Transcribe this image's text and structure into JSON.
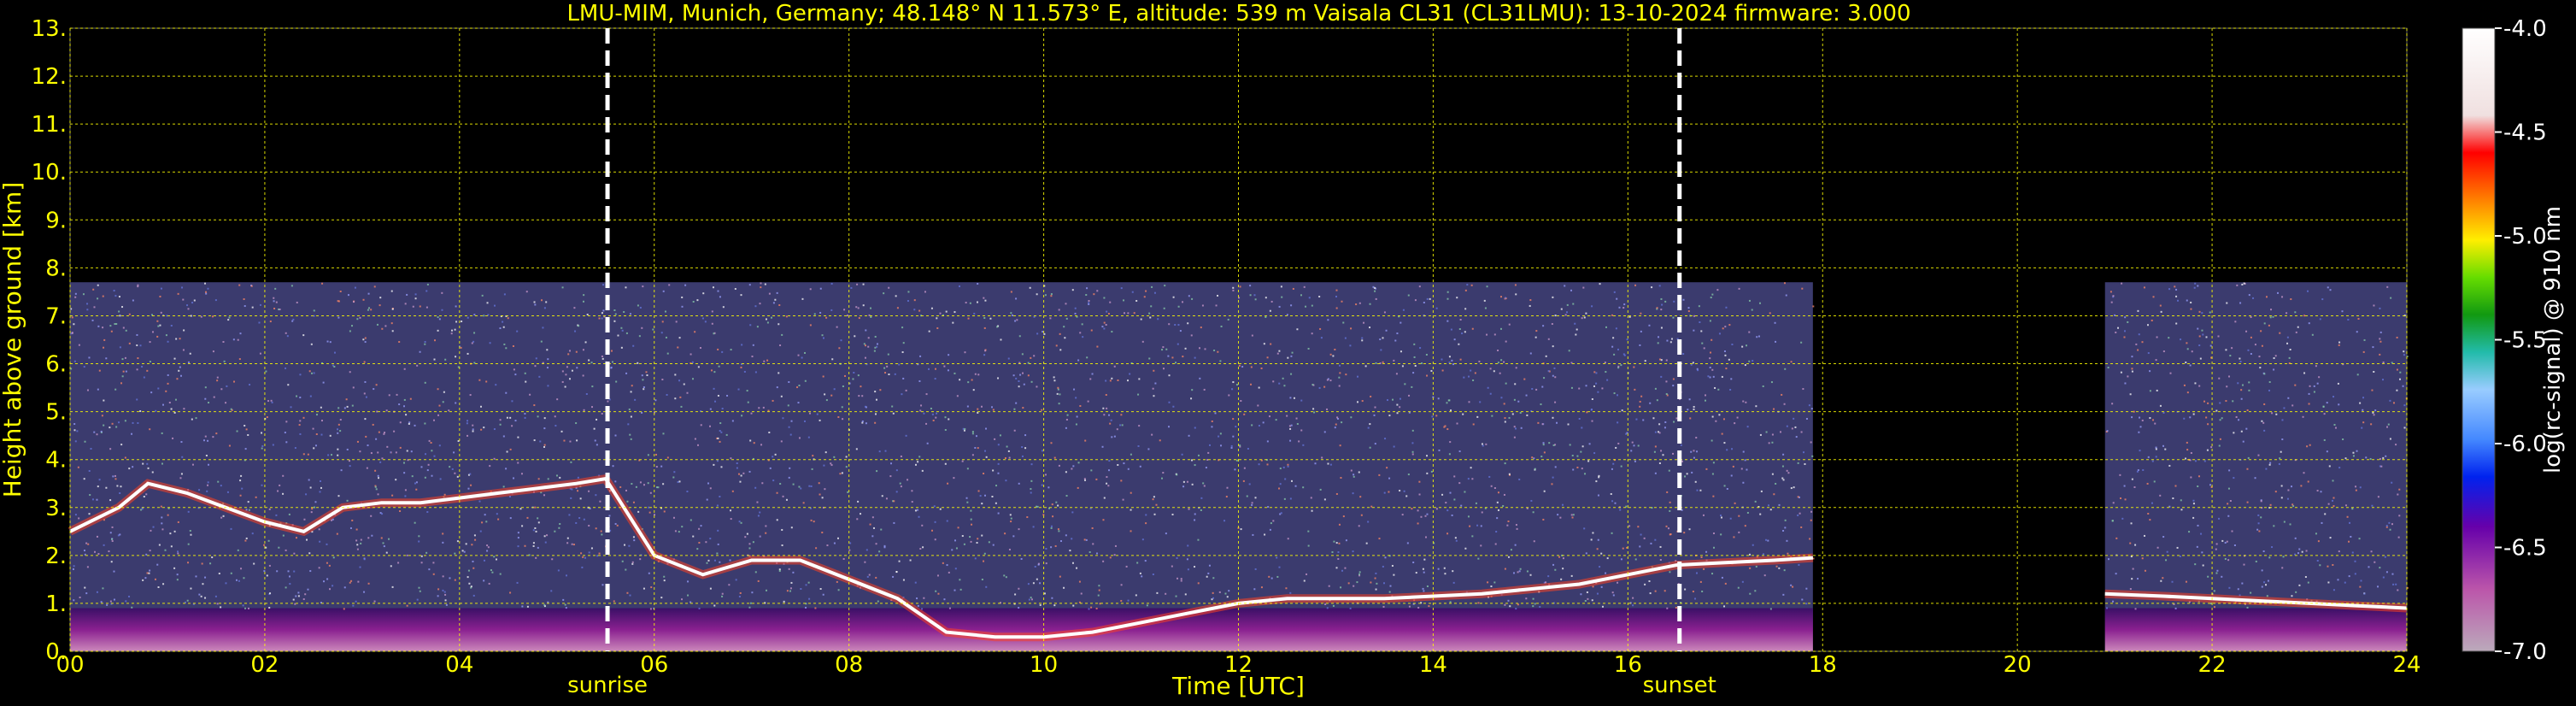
{
  "chart_data": {
    "type": "heatmap",
    "title": "LMU-MIM, Munich, Germany; 48.148° N 11.573° E, altitude: 539 m    Vaisala CL31 (CL31LMU): 13-10-2024    firmware: 3.000",
    "xlabel": "Time [UTC]",
    "ylabel": "Height above ground [km]",
    "xlim": [
      0,
      24
    ],
    "ylim": [
      0,
      13
    ],
    "x_ticks": [
      "00",
      "02",
      "04",
      "06",
      "08",
      "10",
      "12",
      "14",
      "16",
      "18",
      "20",
      "22",
      "24"
    ],
    "y_ticks": [
      "0.",
      "1.",
      "2.",
      "3.",
      "4.",
      "5.",
      "6.",
      "7.",
      "8.",
      "9.",
      "10.",
      "11.",
      "12.",
      "13."
    ],
    "grid": true,
    "colorbar": {
      "label": "log(rc-signal) @ 910 nm",
      "range": [
        -7.0,
        -4.0
      ],
      "ticks": [
        "-4.0",
        "-4.5",
        "-5.0",
        "-5.5",
        "-6.0",
        "-6.5",
        "-7.0"
      ]
    },
    "markers": [
      {
        "label": "sunrise",
        "time_utc": 5.52
      },
      {
        "label": "sunset",
        "time_utc": 16.53
      }
    ],
    "data_gaps_utc": [
      [
        17.9,
        20.9
      ]
    ],
    "signal_top_km": 7.7,
    "boundary_layer_top": {
      "x": [
        0.0,
        0.5,
        0.8,
        1.2,
        1.6,
        2.0,
        2.4,
        2.8,
        3.2,
        3.6,
        4.0,
        4.4,
        4.8,
        5.2,
        5.5,
        6.0,
        6.5,
        7.0,
        7.5,
        8.0,
        8.5,
        9.0,
        9.5,
        10.0,
        10.5,
        11.0,
        11.5,
        12.0,
        12.5,
        13.0,
        13.5,
        14.0,
        14.5,
        15.0,
        15.5,
        16.0,
        16.5,
        17.0,
        17.5,
        17.9,
        20.9,
        21.5,
        22.0,
        22.5,
        23.0,
        23.5,
        24.0
      ],
      "y": [
        2.5,
        3.0,
        3.5,
        3.3,
        3.0,
        2.7,
        2.5,
        3.0,
        3.1,
        3.1,
        3.2,
        3.3,
        3.4,
        3.5,
        3.6,
        2.0,
        1.6,
        1.9,
        1.9,
        1.5,
        1.1,
        0.4,
        0.3,
        0.3,
        0.4,
        0.6,
        0.8,
        1.0,
        1.1,
        1.1,
        1.1,
        1.15,
        1.2,
        1.3,
        1.4,
        1.6,
        1.8,
        1.85,
        1.9,
        1.95,
        1.2,
        1.15,
        1.1,
        1.05,
        1.0,
        0.95,
        0.9
      ]
    },
    "colors": {
      "background": "#000000",
      "text": "#ffff00",
      "grid": "#ffff00",
      "marker": "#ffffff"
    }
  }
}
